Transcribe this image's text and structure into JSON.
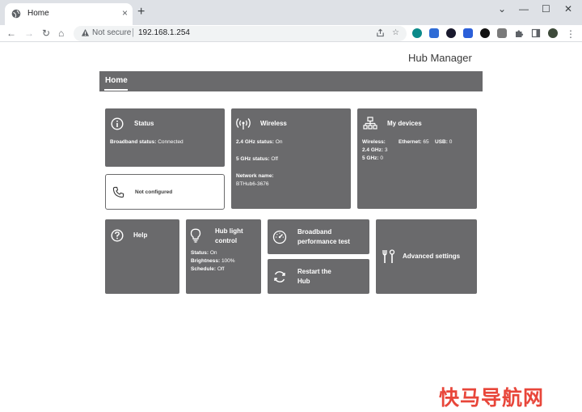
{
  "browser": {
    "tab_title": "Home",
    "tab_close": "×",
    "new_tab": "+",
    "window_controls": [
      "⌄",
      "—",
      "☐",
      "✕"
    ],
    "omnibox": {
      "security_label": "Not secure",
      "separator": "|",
      "url": "192.168.1.254"
    },
    "nav": {
      "back": "←",
      "forward": "→",
      "reload": "↻",
      "home": "⌂"
    },
    "extensions": [
      {
        "name": "extension-1",
        "color": "#0b8a8a"
      },
      {
        "name": "extension-2",
        "color": "#2f6cd6"
      },
      {
        "name": "extension-3",
        "color": "#1a1a2e"
      },
      {
        "name": "extension-4",
        "color": "#2b5fd9"
      },
      {
        "name": "extension-5",
        "color": "#111111"
      },
      {
        "name": "extension-6",
        "color": "#7a7a7a"
      },
      {
        "name": "extension-7",
        "color": "#555555"
      }
    ]
  },
  "page": {
    "brand": "Hub Manager",
    "nav": {
      "home": "Home"
    }
  },
  "cards": {
    "status": {
      "title": "Status",
      "broadband_label": "Broadband status:",
      "broadband_value": "Connected"
    },
    "wireless": {
      "title": "Wireless",
      "ghz24_label": "2.4 GHz status:",
      "ghz24_value": "On",
      "ghz5_label": "5 GHz status:",
      "ghz5_value": "Off",
      "network_label": "Network name:",
      "network_value": "BTHub6-3676"
    },
    "devices": {
      "title": "My devices",
      "wireless_label": "Wireless:",
      "ethernet_label": "Ethernet:",
      "ethernet_value": "65",
      "usb_label": "USB:",
      "usb_value": "0",
      "ghz24_label": "2.4 GHz:",
      "ghz24_value": "3",
      "ghz5_label": "5 GHz:",
      "ghz5_value": "0"
    },
    "phone": {
      "label": "Not configured"
    },
    "help": {
      "title": "Help"
    },
    "hub_light": {
      "title_line1": "Hub light",
      "title_line2": "control",
      "status_label": "Status:",
      "status_value": "On",
      "brightness_label": "Brightness:",
      "brightness_value": "100%",
      "schedule_label": "Schedule:",
      "schedule_value": "Off"
    },
    "broadband_test": {
      "line1": "Broadband",
      "line2": "performance test"
    },
    "restart": {
      "line1": "Restart the",
      "line2": "Hub"
    },
    "advanced": {
      "title": "Advanced settings"
    }
  },
  "watermark": "快马导航网",
  "colors": {
    "card": "#6a6a6c",
    "nav": "#6a6a6c",
    "watermark": "#e8463a"
  }
}
